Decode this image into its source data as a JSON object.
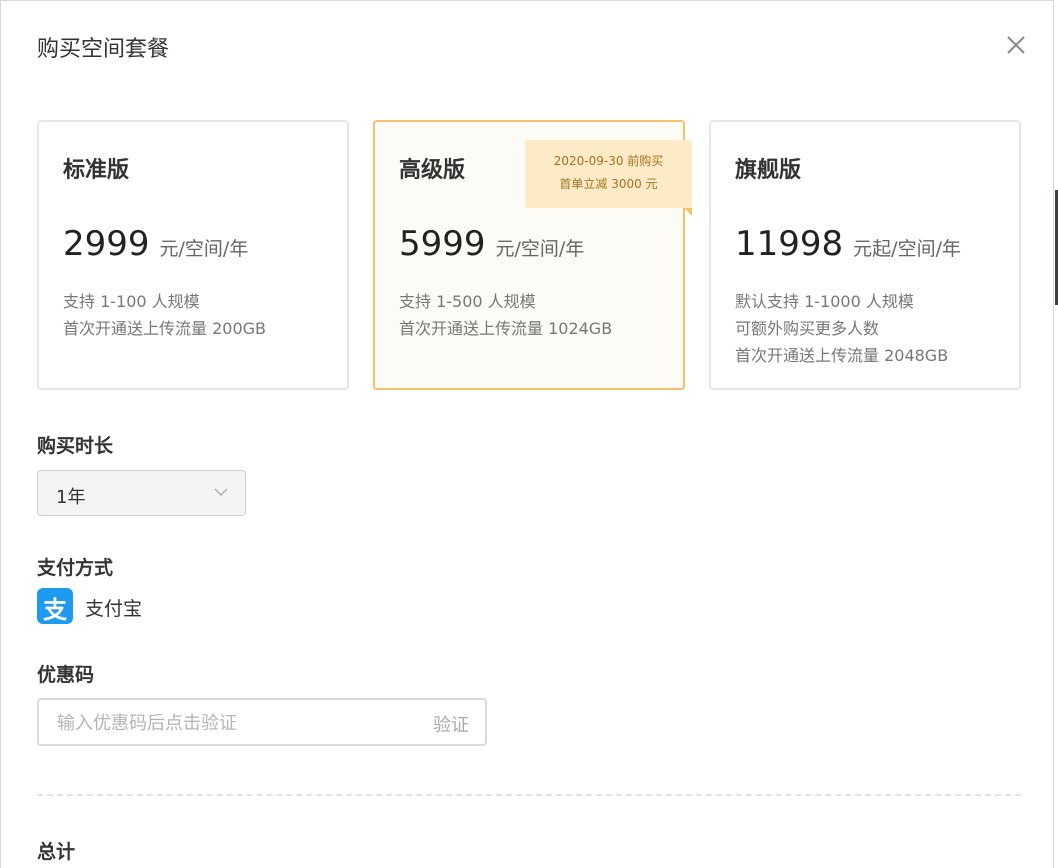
{
  "dialog": {
    "title": "购买空间套餐",
    "close_icon": "close-icon"
  },
  "plans": [
    {
      "name": "标准版",
      "price": "2999",
      "unit": "元/空间/年",
      "desc": [
        "支持 1-100 人规模",
        "首次开通送上传流量 200GB"
      ],
      "selected": false
    },
    {
      "name": "高级版",
      "price": "5999",
      "unit": "元/空间/年",
      "desc": [
        "支持 1-500 人规模",
        "首次开通送上传流量 1024GB"
      ],
      "selected": true,
      "promo": [
        "2020-09-30 前购买",
        "首单立减 3000 元"
      ]
    },
    {
      "name": "旗舰版",
      "price": "11998",
      "unit": "元起/空间/年",
      "desc": [
        "默认支持 1-1000 人规模",
        "可额外购买更多人数",
        "首次开通送上传流量 2048GB"
      ],
      "selected": false
    }
  ],
  "duration": {
    "label": "购买时长",
    "value": "1年"
  },
  "payment": {
    "label": "支付方式",
    "method": "支付宝",
    "icon": "alipay-icon",
    "icon_glyph": "支"
  },
  "coupon": {
    "label": "优惠码",
    "placeholder": "输入优惠码后点击验证",
    "verify": "验证"
  },
  "total": {
    "label": "总计"
  },
  "colors": {
    "selected_border": "#f5c168",
    "promo_bg": "#fdebc8",
    "promo_text": "#a8721c",
    "alipay": "#1e9bf0"
  }
}
